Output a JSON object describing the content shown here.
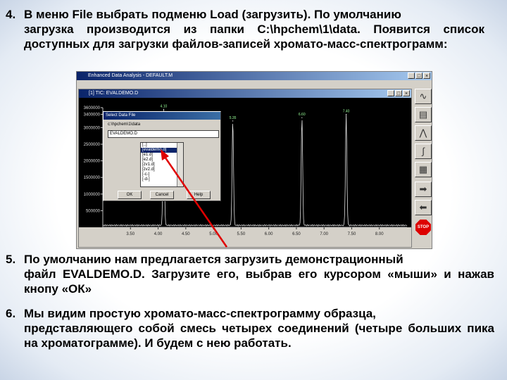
{
  "text": {
    "p4_num": "4.",
    "p4_line1": "В меню File выбрать подменю Load (загрузить). По умолчанию",
    "p4_rest": "загрузка производится из папки C:\\hpchem\\1\\data. Появится список доступных для загрузки файлов-записей хромато-масс-спектрограмм:",
    "p5_num": "5.",
    "p5_line1": "По умолчанию нам предлагается загрузить демонстрационный",
    "p5_rest": "файл EVALDEMO.D. Загрузите его, выбрав его курсором «мыши» и нажав кнопу «ОК»",
    "p6_num": "6.",
    "p6_line1": "Мы видим простую хромато-масс-спектрограмму образца,",
    "p6_rest": "представляющего собой смесь четырех соединений (четыре больших пика на хроматограмме). И будем с нею работать."
  },
  "app": {
    "title": "Enhanced Data Analysis - DEFAULT.M",
    "window_buttons": [
      "_",
      "□",
      "×"
    ],
    "plot_window_title": "[1] TIC: EVALDEMO.D",
    "plot_window_buttons": [
      "_",
      "□",
      "×"
    ],
    "toolbar_icons": [
      "spectrum-icon",
      "library-icon",
      "peak-icon",
      "integrate-icon",
      "report-icon",
      "arrow-right-icon",
      "arrow-left-icon"
    ],
    "stop_label": "STOP"
  },
  "dialog": {
    "title": "Select Data File",
    "path": "c:\\hpchem\\1\\data",
    "input_value": "EVALDEMO.D",
    "files": [
      "[..]",
      "[evaldemo.d]",
      "[e1.d]",
      "[e2.d]",
      "[zv1.d]",
      "[zv2.d]",
      "[-c-]",
      "[-d-]"
    ],
    "selected_index": 1,
    "ok_label": "OK",
    "cancel_label": "Cancel",
    "help_label": "Help"
  },
  "chart_data": {
    "type": "line",
    "title": "",
    "xlabel": "",
    "ylabel": "",
    "y_ticks": [
      3600000,
      3400000,
      3000000,
      2500000,
      2000000,
      1500000,
      1000000,
      500000
    ],
    "y_tick_labels": [
      "3600000",
      "3400000",
      "3000000",
      "2500000",
      "2000000",
      "1500000",
      "1000000",
      "500000"
    ],
    "x_tick_labels": [
      "3.50",
      "4.00",
      "4.50",
      "5.00",
      "5.50",
      "6.00",
      "6.50",
      "7.00",
      "7.50",
      "8.00"
    ],
    "xlim": [
      3.0,
      8.5
    ],
    "ylim": [
      0,
      3600000
    ],
    "peaks": [
      {
        "x": 4.1,
        "y": 3550000,
        "label": "4.10"
      },
      {
        "x": 5.35,
        "y": 3200000,
        "label": "5.35"
      },
      {
        "x": 6.6,
        "y": 3300000,
        "label": "6.60"
      },
      {
        "x": 7.4,
        "y": 3400000,
        "label": "7.40"
      }
    ],
    "series": [
      {
        "color": "#e0e0e0"
      }
    ]
  }
}
